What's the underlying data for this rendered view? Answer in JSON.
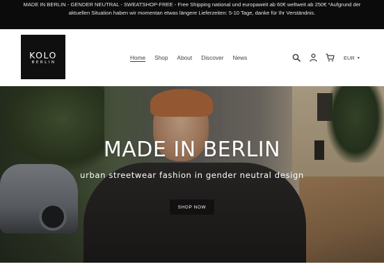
{
  "announcement": {
    "text": "MADE IN BERLIN - GENDER NEUTRAL - SWEATSHOP-FREE - Free Shipping national und europaweit ab 60€ weltweit ab 250€ *Aufgrund der aktuellen Situation haben wir momentan etwas längere Lieferzeiten: 5-10 Tage, danke für Ihr Verständnis."
  },
  "logo": {
    "main": "KOLO",
    "sub": "BERLIN"
  },
  "nav": {
    "items": [
      {
        "label": "Home",
        "active": true
      },
      {
        "label": "Shop",
        "active": false
      },
      {
        "label": "About",
        "active": false
      },
      {
        "label": "Discover",
        "active": false
      },
      {
        "label": "News",
        "active": false
      }
    ]
  },
  "header_icons": {
    "search": "search-icon",
    "account": "user-icon",
    "cart": "cart-icon",
    "currency": "EUR"
  },
  "hero": {
    "title": "MADE IN BERLIN",
    "subtitle": "urban streetwear fashion in gender neutral design",
    "button_label": "SHOP NOW"
  },
  "colors": {
    "announcement_bg": "#0b0b0b",
    "button_bg": "#111111",
    "text": "#3d4246"
  }
}
